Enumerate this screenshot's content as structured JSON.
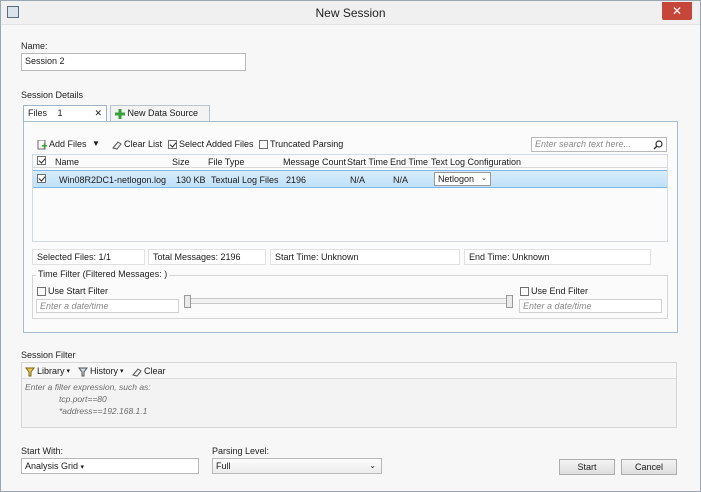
{
  "window": {
    "title": "New Session",
    "close_glyph": "✕"
  },
  "name_section": {
    "label": "Name:",
    "value": "Session 2"
  },
  "session_details": {
    "label": "Session Details",
    "tabs": [
      {
        "label": "Files",
        "count": "1",
        "close_glyph": "✕"
      },
      {
        "label": "New Data Source"
      }
    ],
    "toolbar": {
      "add_files": "Add Files",
      "clear_list": "Clear List",
      "select_added_files": "Select Added Files",
      "truncated_parsing": "Truncated Parsing",
      "search_placeholder": "Enter search text here..."
    },
    "columns": [
      "Name",
      "Size",
      "File Type",
      "Message Count",
      "Start Time",
      "End Time",
      "Text Log Configuration"
    ],
    "rows": [
      {
        "name": "Win08R2DC1-netlogon.log",
        "size": "130 KB",
        "file_type": "Textual Log Files",
        "message_count": "2196",
        "start_time": "N/A",
        "end_time": "N/A",
        "config": "Netlogon"
      }
    ],
    "stats": {
      "selected_files": "Selected Files: 1/1",
      "total_messages": "Total Messages: 2196",
      "start_time": "Start Time: Unknown",
      "end_time": "End Time: Unknown"
    },
    "time_filter": {
      "label": "Time Filter (Filtered Messages: )",
      "use_start_filter": "Use Start Filter",
      "use_end_filter": "Use End Filter",
      "date_placeholder": "Enter a date/time"
    }
  },
  "session_filter": {
    "label": "Session Filter",
    "toolbar": {
      "library": "Library",
      "history": "History",
      "clear": "Clear"
    },
    "hint_lines": [
      "Enter a filter expression, such as:",
      "tcp.port==80",
      "*address==192.168.1.1"
    ]
  },
  "footer": {
    "start_with_label": "Start With:",
    "start_with_value": "Analysis Grid",
    "parsing_level_label": "Parsing Level:",
    "parsing_level_value": "Full",
    "start_button": "Start",
    "cancel_button": "Cancel"
  },
  "colors": {
    "selection_blue": "#bfe0f8",
    "close_red": "#c7463a",
    "add_green": "#3aa03a"
  }
}
